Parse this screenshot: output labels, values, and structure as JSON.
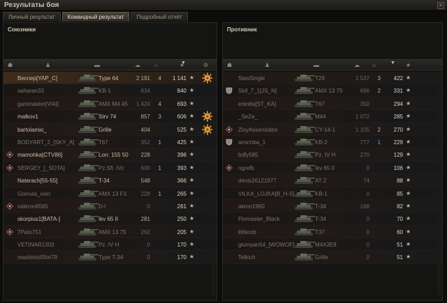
{
  "window": {
    "title": "Результаты боя",
    "close_glyph": "×"
  },
  "tabs": [
    {
      "label": "Личный результат",
      "active": false
    },
    {
      "label": "Командный результат",
      "active": true
    },
    {
      "label": "Подробный отчёт",
      "active": false
    }
  ],
  "columns": {
    "skull_icon": "☗",
    "user_icon": "♟",
    "tank_icon": "▬",
    "damage_icon": "☁",
    "kill_icon": "⌂",
    "xp_icon": "★",
    "medal_icon": "⚙",
    "sort_arrow": "▼"
  },
  "allies": {
    "title": "Союзники",
    "rows": [
      {
        "name": "Веспер[YAP_C]",
        "tank": "Type 64",
        "damage": "2 191",
        "kills": "4",
        "xp": "1 141",
        "alive": true,
        "highlight": true,
        "badge": false,
        "medal": true
      },
      {
        "name": "saharan33",
        "tank": "KB-1",
        "damage": "834",
        "kills": "",
        "xp": "840",
        "alive": false,
        "highlight": false,
        "badge": false,
        "medal": false
      },
      {
        "name": "gammaster[VI4I]",
        "tank": "AMX M4 45",
        "damage": "1 424",
        "kills": "4",
        "xp": "693",
        "alive": false,
        "highlight": false,
        "badge": false,
        "medal": false
      },
      {
        "name": "malkov1",
        "tank": "Strv 74",
        "damage": "857",
        "kills": "3",
        "xp": "606",
        "alive": true,
        "highlight": false,
        "badge": false,
        "medal": true
      },
      {
        "name": "bartolamio_",
        "tank": "Grille",
        "damage": "404",
        "kills": "",
        "xp": "525",
        "alive": true,
        "highlight": false,
        "badge": false,
        "medal": true
      },
      {
        "name": "BODYART_2_[SKY_A]",
        "tank": "T67",
        "damage": "352",
        "kills": "1",
        "xp": "425",
        "alive": false,
        "highlight": false,
        "badge": false,
        "medal": false
      },
      {
        "name": "mamohka[CTV86]",
        "tank": "Lorr. 155 50",
        "damage": "228",
        "kills": "",
        "xp": "396",
        "alive": true,
        "highlight": false,
        "badge": true,
        "medal": false
      },
      {
        "name": "SERGEY_[_SOTA]",
        "tank": "Pz.Sfl. IVc",
        "damage": "600",
        "kills": "1",
        "xp": "393",
        "alive": false,
        "highlight": false,
        "badge": true,
        "medal": false
      },
      {
        "name": "Naterach[55-55]",
        "tank": "T-34",
        "damage": "548",
        "kills": "",
        "xp": "366",
        "alive": true,
        "highlight": false,
        "badge": false,
        "medal": false
      },
      {
        "name": "Gomula_voin",
        "tank": "AMX 13 F3",
        "damage": "228",
        "kills": "1",
        "xp": "265",
        "alive": false,
        "highlight": false,
        "badge": false,
        "medal": false
      },
      {
        "name": "valeron6565",
        "tank": "D-I",
        "damage": "0",
        "kills": "",
        "xp": "261",
        "alive": false,
        "highlight": false,
        "badge": true,
        "medal": false
      },
      {
        "name": "skorpius1[BATA-]",
        "tank": "Ikv 65 II",
        "damage": "281",
        "kills": "",
        "xp": "250",
        "alive": true,
        "highlight": false,
        "badge": false,
        "medal": false
      },
      {
        "name": "7Pato751",
        "tank": "AMX 13 75",
        "damage": "262",
        "kills": "",
        "xp": "205",
        "alive": false,
        "highlight": false,
        "badge": true,
        "medal": false
      },
      {
        "name": "VETINAR1303",
        "tank": "Pz. IV H",
        "damage": "0",
        "kills": "",
        "xp": "170",
        "alive": false,
        "highlight": false,
        "badge": false,
        "medal": false
      },
      {
        "name": "mashinistShe79",
        "tank": "Type T-34",
        "damage": "0",
        "kills": "",
        "xp": "170",
        "alive": false,
        "highlight": false,
        "badge": false,
        "medal": false
      }
    ]
  },
  "enemies": {
    "title": "Противник",
    "rows": [
      {
        "name": "StasSingle",
        "tank": "T29",
        "damage": "1 537",
        "kills": "3",
        "kills_blue": false,
        "xp": "422",
        "alive": false,
        "badge": false,
        "shield": false
      },
      {
        "name": "Skif_7_1[JS_N]",
        "tank": "AMX 13 75",
        "damage": "696",
        "kills": "2",
        "kills_blue": false,
        "xp": "331",
        "alive": false,
        "badge": false,
        "shield": true
      },
      {
        "name": "enirefa[ST_KA]",
        "tank": "T67",
        "damage": "350",
        "kills": "",
        "kills_blue": false,
        "xp": "294",
        "alive": false,
        "badge": false,
        "shield": false
      },
      {
        "name": "_SeZe_",
        "tank": "M44",
        "damage": "1 072",
        "kills": "",
        "kills_blue": false,
        "xp": "285",
        "alive": false,
        "badge": false,
        "shield": false
      },
      {
        "name": "ZloyAssenizator",
        "tank": "CY-14-1",
        "damage": "1 105",
        "kills": "2",
        "kills_blue": false,
        "xp": "270",
        "alive": false,
        "badge": true,
        "shield": false
      },
      {
        "name": "amichba_1",
        "tank": "KB-2",
        "damage": "777",
        "kills": "1",
        "kills_blue": true,
        "xp": "229",
        "alive": false,
        "badge": false,
        "shield": true
      },
      {
        "name": "bdfy585",
        "tank": "Pz. IV H",
        "damage": "270",
        "kills": "",
        "kills_blue": false,
        "xp": "129",
        "alive": false,
        "badge": false,
        "shield": false
      },
      {
        "name": "ngrefb",
        "tank": "Ikv 65 II",
        "damage": "0",
        "kills": "",
        "kills_blue": false,
        "xp": "106",
        "alive": false,
        "badge": true,
        "shield": false
      },
      {
        "name": "denis26121977",
        "tank": "AT 2",
        "damage": "74",
        "kills": "",
        "kills_blue": false,
        "xp": "88",
        "alive": false,
        "badge": false,
        "shield": false
      },
      {
        "name": "VILKA_LOJKA[B_H-S]",
        "tank": "KB-1",
        "damage": "0",
        "kills": "",
        "kills_blue": false,
        "xp": "85",
        "alive": false,
        "badge": false,
        "shield": false
      },
      {
        "name": "akron1990",
        "tank": "T-34",
        "damage": "168",
        "kills": "",
        "kills_blue": false,
        "xp": "82",
        "alive": false,
        "badge": false,
        "shield": false
      },
      {
        "name": "Flomaster_Black",
        "tank": "T-34",
        "damage": "0",
        "kills": "",
        "kills_blue": false,
        "xp": "70",
        "alive": false,
        "badge": false,
        "shield": false
      },
      {
        "name": "littlerob",
        "tank": "T37",
        "damage": "0",
        "kills": "",
        "kills_blue": false,
        "xp": "60",
        "alive": false,
        "badge": false,
        "shield": false
      },
      {
        "name": "glumyan54_[WOWOF]",
        "tank": "M4A3E8",
        "damage": "0",
        "kills": "",
        "kills_blue": false,
        "xp": "51",
        "alive": false,
        "badge": false,
        "shield": false
      },
      {
        "name": "Telkich",
        "tank": "Grille",
        "damage": "0",
        "kills": "",
        "kills_blue": false,
        "xp": "51",
        "alive": false,
        "badge": false,
        "shield": false
      }
    ]
  },
  "colors": {
    "highlight_row": "#3e2b1a",
    "blue_kill": "#4fb6d5",
    "accent_gold": "#e0a84a"
  }
}
